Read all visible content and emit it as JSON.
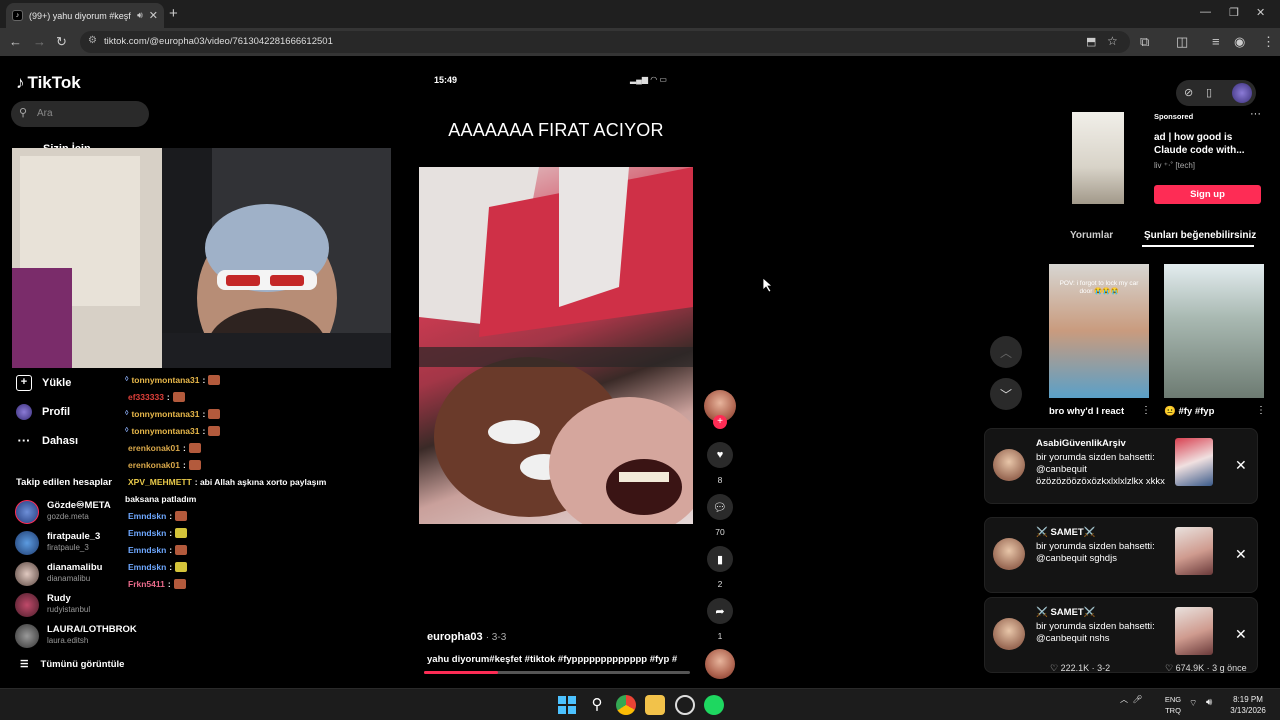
{
  "browser": {
    "tab_title": "(99+) yahu diyorum #keşfet",
    "url": "tiktok.com/@europha03/video/7613042281666612501"
  },
  "sidebar": {
    "logo": "TikTok",
    "search_placeholder": "Ara",
    "for_you": "Sizin İçin",
    "nav": [
      {
        "label": "Yükle"
      },
      {
        "label": "Profil"
      },
      {
        "label": "Dahası"
      }
    ],
    "following_header": "Takip edilen hesaplar",
    "following": [
      {
        "name": "Gözde♾META",
        "handle": "gozde.meta"
      },
      {
        "name": "firatpaule_3",
        "handle": "firatpaule_3"
      },
      {
        "name": "dianamalibu",
        "handle": "dianamalibu"
      },
      {
        "name": "Rudy",
        "handle": "rudyistanbul"
      },
      {
        "name": "LAURA/LOTHBROK",
        "handle": "laura.editsh"
      }
    ],
    "see_all": "Tümünü görüntüle"
  },
  "chat": [
    {
      "user": "tonnymontana31",
      "text": ":",
      "color": "#e8b84a",
      "emote": "brown"
    },
    {
      "user": "ef333333",
      "text": ":",
      "color": "#e0403a",
      "emote": "brown"
    },
    {
      "user": "tonnymontana31",
      "text": ":",
      "color": "#e8b84a",
      "emote": "brown"
    },
    {
      "user": "tonnymontana31",
      "text": ":",
      "color": "#e8b84a",
      "emote": "brown"
    },
    {
      "user": "erenkonak01",
      "text": ":",
      "color": "#d9a84a",
      "emote": "brown"
    },
    {
      "user": "erenkonak01",
      "text": ":",
      "color": "#d9a84a",
      "emote": "brown"
    },
    {
      "user": "XPV_MEHMETT",
      "text": ": abi Allah aşkına xorto paylaşım",
      "color": "#e8c94a",
      "emote": ""
    },
    {
      "user": "",
      "text": "baksana patladım",
      "color": "#ffffff",
      "emote": ""
    },
    {
      "user": "Emndskn",
      "text": ":",
      "color": "#6ea8ff",
      "emote": "brown"
    },
    {
      "user": "Emndskn",
      "text": ":",
      "color": "#6ea8ff",
      "emote": "yellow"
    },
    {
      "user": "Emndskn",
      "text": ":",
      "color": "#6ea8ff",
      "emote": "brown"
    },
    {
      "user": "Emndskn",
      "text": ":",
      "color": "#6ea8ff",
      "emote": "yellow"
    },
    {
      "user": "Frkn5411",
      "text": ":",
      "color": "#e86a8a",
      "emote": "brown"
    }
  ],
  "video": {
    "status_time": "15:49",
    "caption": "AAAAAAA FIRAT ACIYOR",
    "author": "europha03",
    "date": "· 3-3",
    "description": "yahu diyorum#keşfet #tiktok #fyppppppppppppp #fyp #",
    "progress": 0.28,
    "likes": "8",
    "comments": "70",
    "saves": "2",
    "shares": "1"
  },
  "right": {
    "sponsored": "Sponsored",
    "ad_title": "ad | how good is Claude code with...",
    "ad_handle": "liv ⁺‧˚ [tech]",
    "signup": "Sign up",
    "tab_comments": "Yorumlar",
    "tab_like": "Şunları beğenebilirsiniz",
    "thumb1_caption": "bro why'd I react",
    "thumb1_overlay": "POV: i forgot to lock my car door 😭😭😭",
    "thumb2_caption": "😐 #fy #fyp",
    "stats_left": "♡ 222.1K · 3-2",
    "stats_right": "♡ 674.9K · 3 g önce"
  },
  "notifications": [
    {
      "name": "AsabiGüvenlikArşiv",
      "body": "bir yorumda sizden bahsetti: @canbequit özözözöözöxözkxlxlxlzlkx xkkx"
    },
    {
      "name": "⚔️ SAMET⚔️",
      "body": "bir yorumda sizden bahsetti: @canbequit sghdjs"
    },
    {
      "name": "⚔️ SAMET⚔️",
      "body": "bir yorumda sizden bahsetti: @canbequit nshs"
    }
  ],
  "taskbar": {
    "lang1": "ENG",
    "lang2": "TRQ",
    "time": "8:19 PM",
    "date": "3/13/2026"
  },
  "colors": {
    "accent": "#fe2c55",
    "background": "#000000",
    "chrome": "#353535"
  }
}
